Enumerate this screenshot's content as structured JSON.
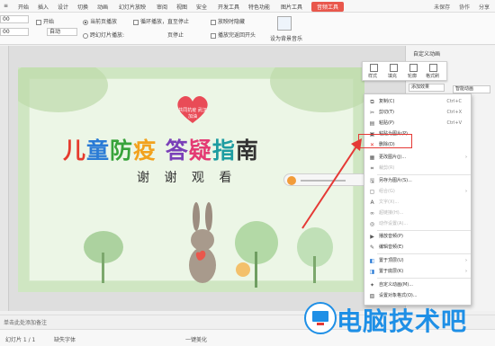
{
  "tabs": [
    "开始",
    "插入",
    "设计",
    "切换",
    "动画",
    "幻灯片放映",
    "审阅",
    "视图",
    "安全",
    "开发工具",
    "特色功能",
    "图片工具",
    "音频工具"
  ],
  "active_tab": "音频工具",
  "user": {
    "sync": "未保存",
    "share": "协作",
    "more": "分享"
  },
  "ribbon": {
    "start_label": "开始",
    "start_value": "自动",
    "vol_value": "00",
    "time_value": "00",
    "radio_current": "当前页播放",
    "radio_cross": "跨幻灯片播放:",
    "to_page_value": "至",
    "page_stop": "页停止",
    "loop": "循环播放，直至停止",
    "hide": "放映时隐藏",
    "rewind": "播放完返回开头",
    "set_bgm": "设为背景音乐"
  },
  "slide": {
    "title_chars": [
      "儿",
      "童",
      "防",
      "疫",
      " ",
      "答",
      "疑",
      "指",
      "南"
    ],
    "subtitle": "谢 谢 观 看",
    "badge": "共同抗疫 武汉加油"
  },
  "panel": {
    "header": "自定义动画",
    "add_effect": "添加效果",
    "smart_anim": "智能动画"
  },
  "minibar": [
    "样式",
    "填充",
    "轮廓",
    "格式刷"
  ],
  "context_menu": [
    {
      "icon": "copy-icon",
      "label": "复制(C)",
      "shortcut": "Ctrl+C"
    },
    {
      "icon": "cut-icon",
      "label": "剪切(T)",
      "shortcut": "Ctrl+X"
    },
    {
      "icon": "paste-icon",
      "label": "粘贴(P)",
      "shortcut": "Ctrl+V"
    },
    {
      "icon": "paste-image-icon",
      "label": "粘贴为图片(P)",
      "shortcut": ""
    },
    {
      "icon": "delete-icon",
      "label": "删除(D)",
      "shortcut": ""
    },
    {
      "icon": "change-image-icon",
      "label": "更改图片(J)...",
      "shortcut": ""
    },
    {
      "icon": "crop-icon",
      "label": "裁剪(R)",
      "shortcut": ""
    },
    {
      "icon": "save-image-icon",
      "label": "另存为图片(S)...",
      "shortcut": ""
    },
    {
      "icon": "combine-icon",
      "label": "组合(G)",
      "shortcut": ""
    },
    {
      "icon": "text-icon",
      "label": "文字(X)...",
      "shortcut": ""
    },
    {
      "icon": "hyperlink-icon",
      "label": "超链接(H)...",
      "shortcut": ""
    },
    {
      "icon": "action-icon",
      "label": "动作设置(A)...",
      "shortcut": ""
    },
    {
      "icon": "play-icon",
      "label": "播放音频(P)",
      "shortcut": ""
    },
    {
      "icon": "edit-icon",
      "label": "编辑音频(E)",
      "shortcut": ""
    },
    {
      "icon": "bring-front-icon",
      "label": "置于顶层(U)",
      "shortcut": ""
    },
    {
      "icon": "send-back-icon",
      "label": "置于底层(K)",
      "shortcut": ""
    },
    {
      "icon": "custom-anim-icon",
      "label": "自定义动画(M)...",
      "shortcut": ""
    },
    {
      "icon": "format-icon",
      "label": "设置对象格式(O)...",
      "shortcut": ""
    }
  ],
  "notes": "单击此处添加备注",
  "status": {
    "slide": "幻灯片 1 / 1",
    "font": "缺失字体",
    "beautify": "一键美化"
  },
  "watermark": "电脑技术吧"
}
